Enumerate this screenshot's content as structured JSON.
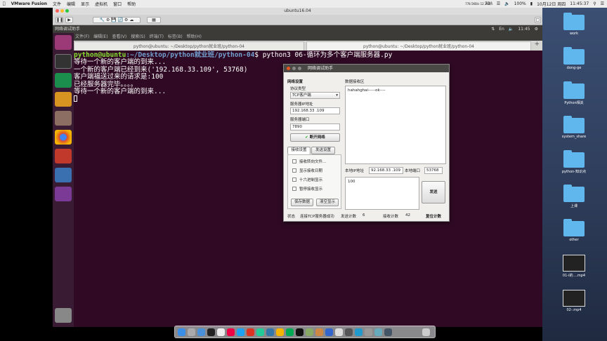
{
  "mac_menu": {
    "app": "VMware Fusion",
    "items": [
      "文件",
      "编辑",
      "显示",
      "虚拟机",
      "窗口",
      "帮助"
    ],
    "net_speed": "778.5KB/s 12.1KB/s",
    "temp": "73°",
    "battery": "100%",
    "datetime": "10月12日 周四",
    "time": "11:45:37"
  },
  "vm": {
    "title": "ubuntu16.04",
    "app_menu_title": "网络调试助手",
    "panel_time": "11:45"
  },
  "terminal": {
    "menu": [
      "文件(F)",
      "编辑(E)",
      "查看(V)",
      "搜索(S)",
      "终端(T)",
      "标签(B)",
      "帮助(H)"
    ],
    "tabs": [
      "python@ubuntu: ~/Desktop/python就业班/python-04",
      "python@ubuntu: ~/Desktop/python就业班/python-04"
    ],
    "prompt_user": "python@ubuntu",
    "prompt_path": ":~/Desktop/python就业班/python-04",
    "prompt_cmd": "$ python3 06-循环为多个客户端服务器.py",
    "lines": [
      "等待一个新的客户端的到来...",
      "一个新的客户端已经到来('192.168.33.109', 53768)",
      "客户端福送过来的请求是:100",
      "已经服务器完毕。。。。",
      "等待一个新的客户端的到来..."
    ]
  },
  "dialog": {
    "title": "网络调试助手",
    "net_settings": "网络设置",
    "protocol_label": "协议类型",
    "protocol_value": "TCP客户端",
    "server_ip_label": "服务器IP地址",
    "server_ip": "192.168.33 .109",
    "server_port_label": "服务器端口",
    "server_port": "7890",
    "disconnect_btn": "断开网络",
    "tab_recv": "接收设置",
    "tab_send": "发送设置",
    "recv_options": [
      "接收转向文件...",
      "显示接收日期",
      "十六进制显示",
      "暂停接收显示"
    ],
    "save_btn": "保存数据",
    "clear_btn": "清空显示",
    "recv_area_label": "数据接收区",
    "recv_text": "hahahghai-----ok----",
    "local_ip_label": "本地IP地址",
    "local_ip": "92.168.33 .109",
    "local_port_label": "本地端口",
    "local_port": "53768",
    "send_text": "100",
    "send_btn": "发送",
    "status_label": "状态",
    "status_text": "连接TCP服务器成功",
    "send_count_label": "发送计数",
    "send_count": "6",
    "recv_count_label": "接收计数",
    "recv_count": "42",
    "reset_btn": "复位计数"
  },
  "desktop_icons": [
    "work",
    "dong-ge",
    "Python相关",
    "system_share",
    "python-知识点",
    "上课",
    "other",
    "01-i的....mp4",
    "02-.mp4"
  ]
}
